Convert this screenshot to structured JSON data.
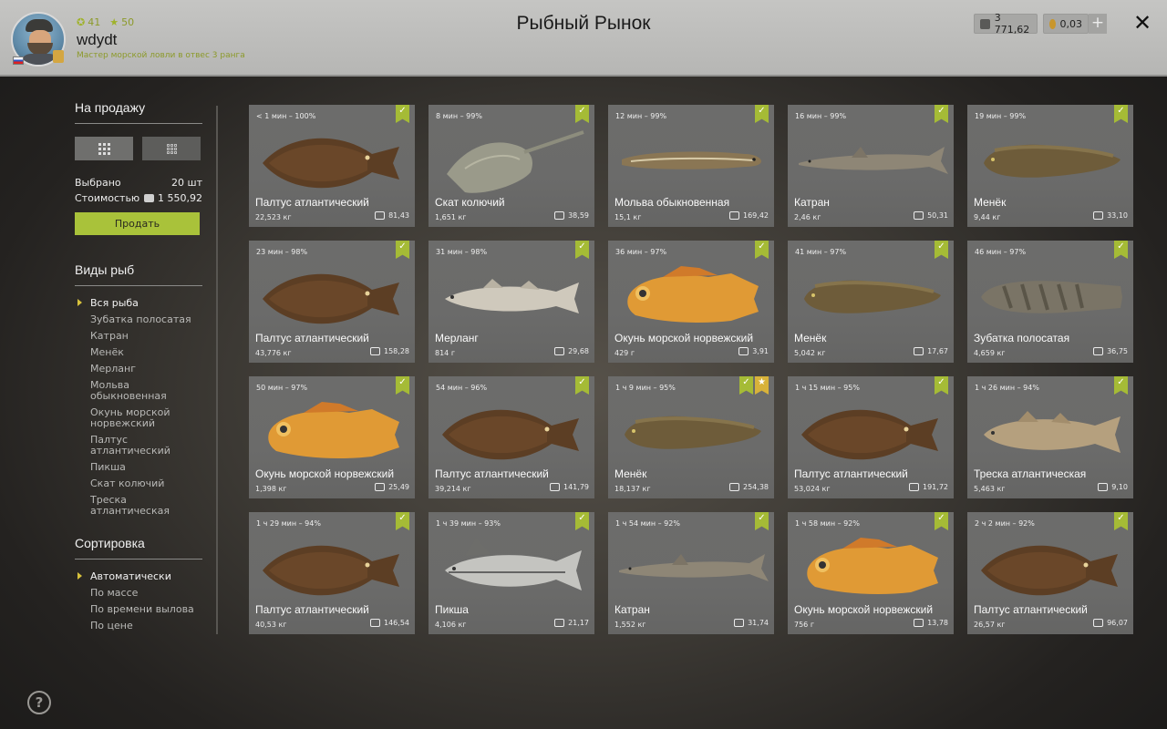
{
  "header": {
    "stat_level": "41",
    "stat_stars": "50",
    "username": "wdydt",
    "subtitle": "Мастер морской ловли в отвес 3 ранга",
    "title": "Рыбный Рынок",
    "silver": "3 771,62",
    "gold": "0,03"
  },
  "sidebar": {
    "sale_title": "На продажу",
    "selected_label": "Выбрано",
    "selected_value": "20 шт",
    "cost_label": "Стоимостью",
    "cost_value": "1 550,92",
    "sell_label": "Продать",
    "species_title": "Виды рыб",
    "species": [
      "Вся рыба",
      "Зубатка полосатая",
      "Катран",
      "Менёк",
      "Мерланг",
      "Мольва обыкновенная",
      "Окунь морской норвежский",
      "Палтус атлантический",
      "Пикша",
      "Скат колючий",
      "Треска атлантическая"
    ],
    "sort_title": "Сортировка",
    "sort": [
      "Автоматически",
      "По массе",
      "По времени вылова",
      "По цене"
    ]
  },
  "cards": [
    {
      "time": "< 1 мин – 100%",
      "name": "Палтус атлантический",
      "weight": "22,523 кг",
      "price": "81,43",
      "kind": "flatfish"
    },
    {
      "time": "8 мин – 99%",
      "name": "Скат колючий",
      "weight": "1,651 кг",
      "price": "38,59",
      "kind": "ray"
    },
    {
      "time": "12 мин – 99%",
      "name": "Мольва обыкновенная",
      "weight": "15,1 кг",
      "price": "169,42",
      "kind": "ling"
    },
    {
      "time": "16 мин – 99%",
      "name": "Катран",
      "weight": "2,46 кг",
      "price": "50,31",
      "kind": "shark"
    },
    {
      "time": "19 мин – 99%",
      "name": "Менёк",
      "weight": "9,44 кг",
      "price": "33,10",
      "kind": "cusk"
    },
    {
      "time": "23 мин – 98%",
      "name": "Палтус атлантический",
      "weight": "43,776 кг",
      "price": "158,28",
      "kind": "flatfish"
    },
    {
      "time": "31 мин – 98%",
      "name": "Мерланг",
      "weight": "814 г",
      "price": "29,68",
      "kind": "whiting"
    },
    {
      "time": "36 мин – 97%",
      "name": "Окунь морской норвежский",
      "weight": "429 г",
      "price": "3,91",
      "kind": "redfish"
    },
    {
      "time": "41 мин – 97%",
      "name": "Менёк",
      "weight": "5,042 кг",
      "price": "17,67",
      "kind": "cusk"
    },
    {
      "time": "46 мин – 97%",
      "name": "Зубатка полосатая",
      "weight": "4,659 кг",
      "price": "36,75",
      "kind": "wolffish"
    },
    {
      "time": "50 мин – 97%",
      "name": "Окунь морской норвежский",
      "weight": "1,398 кг",
      "price": "25,49",
      "kind": "redfish"
    },
    {
      "time": "54 мин – 96%",
      "name": "Палтус атлантический",
      "weight": "39,214 кг",
      "price": "141,79",
      "kind": "flatfish"
    },
    {
      "time": "1 ч 9 мин – 95%",
      "name": "Менёк",
      "weight": "18,137 кг",
      "price": "254,38",
      "kind": "cusk",
      "star": true
    },
    {
      "time": "1 ч 15 мин – 95%",
      "name": "Палтус атлантический",
      "weight": "53,024 кг",
      "price": "191,72",
      "kind": "flatfish"
    },
    {
      "time": "1 ч 26 мин – 94%",
      "name": "Треска атлантическая",
      "weight": "5,463 кг",
      "price": "9,10",
      "kind": "cod"
    },
    {
      "time": "1 ч 29 мин – 94%",
      "name": "Палтус атлантический",
      "weight": "40,53 кг",
      "price": "146,54",
      "kind": "flatfish"
    },
    {
      "time": "1 ч 39 мин – 93%",
      "name": "Пикша",
      "weight": "4,106 кг",
      "price": "21,17",
      "kind": "haddock"
    },
    {
      "time": "1 ч 54 мин – 92%",
      "name": "Катран",
      "weight": "1,552 кг",
      "price": "31,74",
      "kind": "shark"
    },
    {
      "time": "1 ч 58 мин – 92%",
      "name": "Окунь морской норвежский",
      "weight": "756 г",
      "price": "13,78",
      "kind": "redfish"
    },
    {
      "time": "2 ч 2 мин – 92%",
      "name": "Палтус атлантический",
      "weight": "26,57 кг",
      "price": "96,07",
      "kind": "flatfish"
    }
  ]
}
